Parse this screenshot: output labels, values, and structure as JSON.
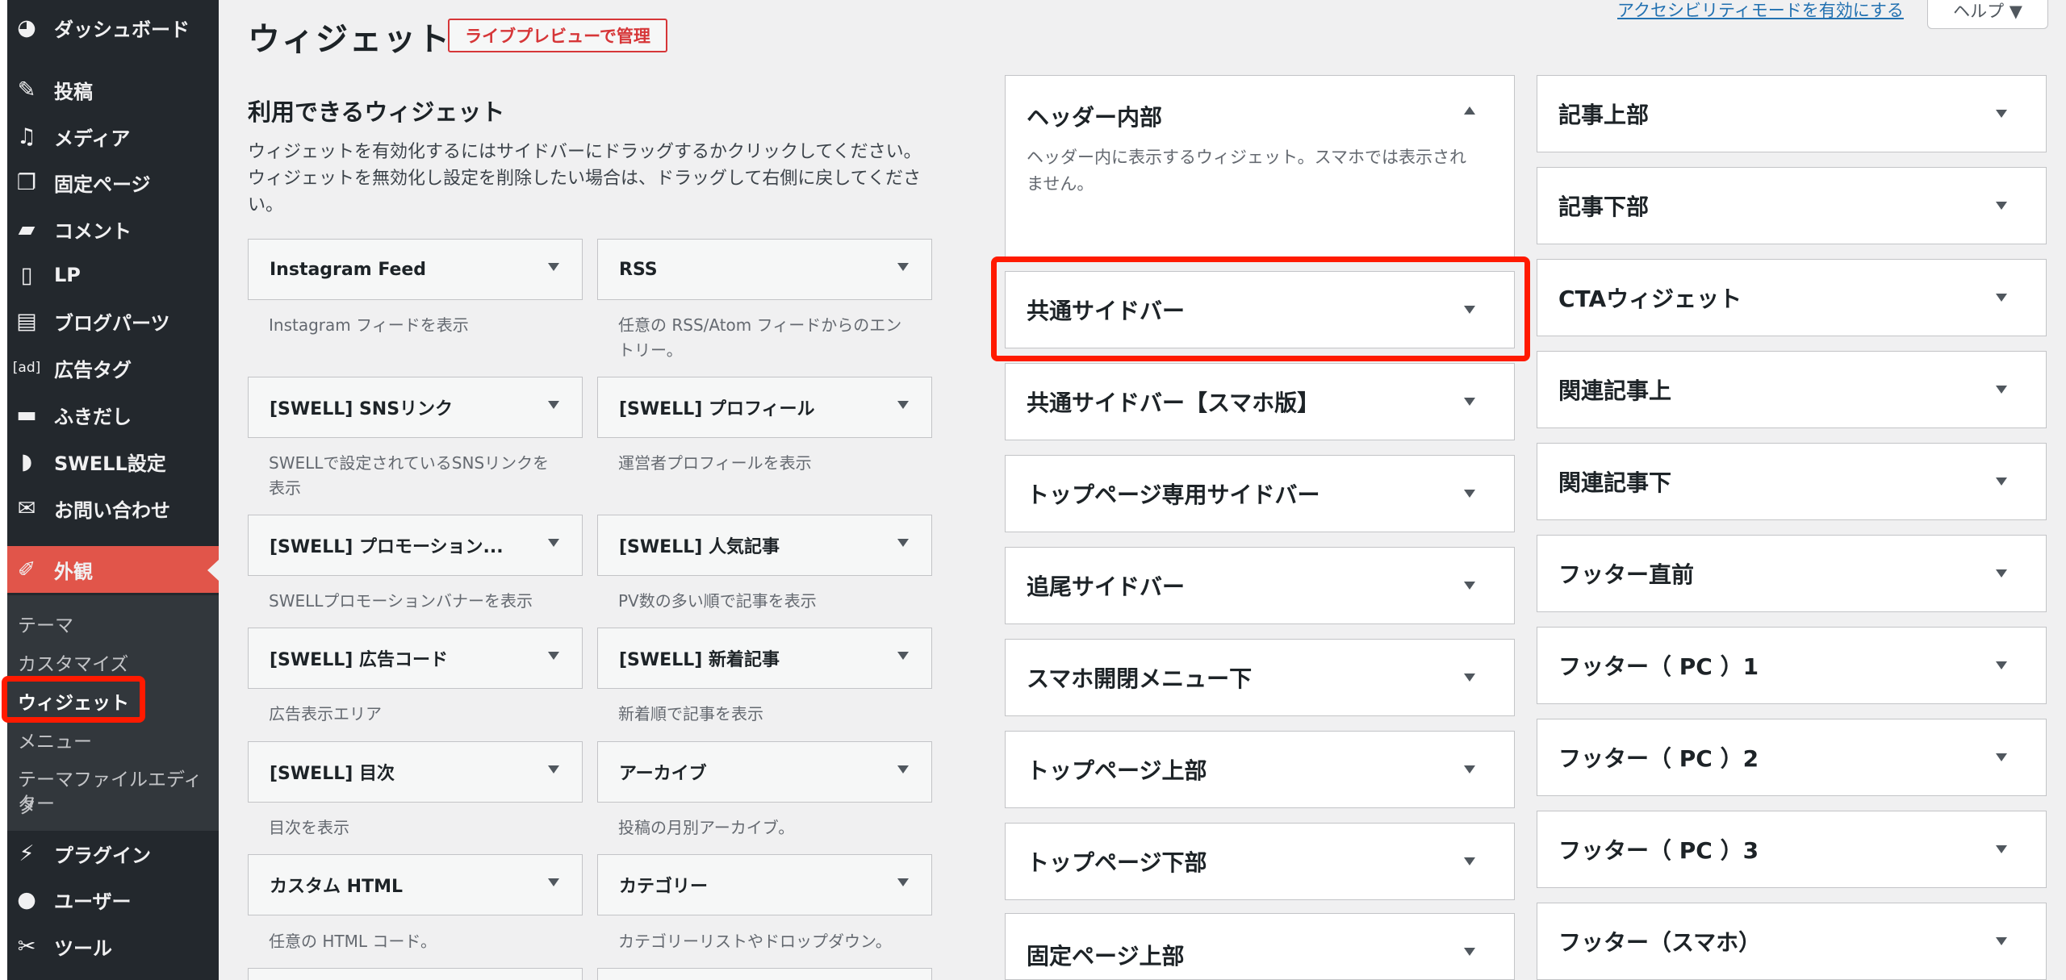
{
  "sidebar": {
    "menu": [
      {
        "label": "ダッシュボード",
        "icon": "dashboard-icon",
        "glyph": "◕"
      },
      {
        "label": "投稿",
        "icon": "pin-icon",
        "glyph": "✎"
      },
      {
        "label": "メディア",
        "icon": "media-icon",
        "glyph": "♫"
      },
      {
        "label": "固定ページ",
        "icon": "page-icon",
        "glyph": "❐"
      },
      {
        "label": "コメント",
        "icon": "comment-icon",
        "glyph": "▰"
      },
      {
        "label": "LP",
        "icon": "document-icon",
        "glyph": "▯"
      },
      {
        "label": "ブログパーツ",
        "icon": "table-icon",
        "glyph": "▤"
      },
      {
        "label": "広告タグ",
        "icon": "ad-icon",
        "glyph": "[ad]"
      },
      {
        "label": "ふきだし",
        "icon": "bubble-icon",
        "glyph": "▬"
      },
      {
        "label": "SWELL設定",
        "icon": "swell-icon",
        "glyph": "◗"
      },
      {
        "label": "お問い合わせ",
        "icon": "mail-icon",
        "glyph": "✉"
      },
      {
        "label": "外観",
        "icon": "brush-icon",
        "glyph": "✐"
      },
      {
        "label": "プラグイン",
        "icon": "plugin-icon",
        "glyph": "⚡"
      },
      {
        "label": "ユーザー",
        "icon": "user-icon",
        "glyph": "●"
      },
      {
        "label": "ツール",
        "icon": "wrench-icon",
        "glyph": "✂"
      }
    ],
    "submenu": [
      "テーマ",
      "カスタマイズ",
      "ウィジェット",
      "メニュー",
      "テーマファイルエディタ",
      "ター"
    ]
  },
  "header": {
    "title": "ウィジェット",
    "live_preview": "ライブプレビューで管理",
    "a11y_link": "アクセシビリティモードを有効にする",
    "help": "ヘルプ ▼"
  },
  "available": {
    "title": "利用できるウィジェット",
    "desc_lines": [
      "ウィジェットを有効化するにはサイドバーにドラッグするかクリックしてください。",
      "ウィジェットを無効化し設定を削除したい場合は、ドラッグして右側に戻してくださ",
      "い。"
    ],
    "widgets": [
      {
        "name": "Instagram Feed",
        "desc": [
          "Instagram フィードを表示"
        ]
      },
      {
        "name": "RSS",
        "desc": [
          "任意の RSS/Atom フィードからのエン",
          "トリー。"
        ]
      },
      {
        "name": "[SWELL] SNSリンク",
        "desc": [
          "SWELLで設定されているSNSリンクを",
          "表示"
        ]
      },
      {
        "name": "[SWELL] プロフィール",
        "desc": [
          "運営者プロフィールを表示"
        ]
      },
      {
        "name": "[SWELL] プロモーション...",
        "desc": [
          "SWELLプロモーションバナーを表示"
        ]
      },
      {
        "name": "[SWELL] 人気記事",
        "desc": [
          "PV数の多い順で記事を表示"
        ]
      },
      {
        "name": "[SWELL] 広告コード",
        "desc": [
          "広告表示エリア"
        ]
      },
      {
        "name": "[SWELL] 新着記事",
        "desc": [
          "新着順で記事を表示"
        ]
      },
      {
        "name": "[SWELL] 目次",
        "desc": [
          "目次を表示"
        ]
      },
      {
        "name": "アーカイブ",
        "desc": [
          "投稿の月別アーカイブ。"
        ]
      },
      {
        "name": "カスタム HTML",
        "desc": [
          "任意の HTML コード。"
        ]
      },
      {
        "name": "カテゴリー",
        "desc": [
          "カテゴリーリストやドロップダウン。"
        ]
      }
    ]
  },
  "areas_col1": {
    "open": {
      "name": "ヘッダー内部",
      "desc_lines": [
        "ヘッダー内に表示するウィジェット。スマホでは表示され",
        "ません。"
      ]
    },
    "items": [
      "共通サイドバー",
      "共通サイドバー【スマホ版】",
      "トップページ専用サイドバー",
      "追尾サイドバー",
      "スマホ開閉メニュー下",
      "トップページ上部",
      "トップページ下部",
      "固定ページ上部"
    ]
  },
  "areas_col2": {
    "items": [
      "記事上部",
      "記事下部",
      "CTAウィジェット",
      "関連記事上",
      "関連記事下",
      "フッター直前",
      "フッター（ PC ）1",
      "フッター（ PC ）2",
      "フッター（ PC ）3",
      "フッター（スマホ）"
    ]
  },
  "colors": {
    "admin_bar": "#23282d",
    "accent": "#e1554a",
    "highlight": "#ff1a00",
    "link": "#2271b1"
  }
}
